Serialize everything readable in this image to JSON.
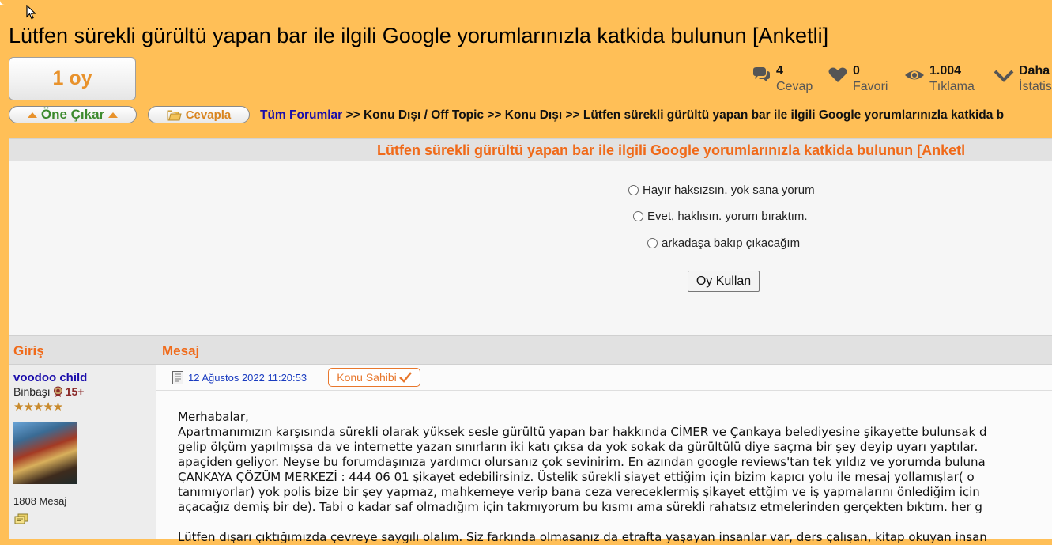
{
  "topic": {
    "title": "Lütfen sürekli gürültü yapan bar ile ilgili Google yorumlarınızla katkida bulunun [Anketli]"
  },
  "vote": {
    "label": "1 oy"
  },
  "actions": {
    "feature_label": "Öne Çıkar",
    "reply_label": "Cevapla"
  },
  "breadcrumb": {
    "items": [
      "Tüm Forumlar",
      "Konu Dışı / Off Topic",
      "Konu Dışı",
      "Lütfen sürekli gürültü yapan bar ile ilgili Google yorumlarınızla katkida b"
    ],
    "separator": ">>"
  },
  "stats": {
    "replies": {
      "value": "4",
      "label": "Cevap",
      "icon": "comments-icon"
    },
    "favorites": {
      "value": "0",
      "label": "Favori",
      "icon": "heart-icon"
    },
    "views": {
      "value": "1.004",
      "label": "Tıklama",
      "icon": "eye-icon"
    },
    "more": {
      "value": "Daha",
      "label": "İstatis",
      "icon": "chevron-down-icon"
    }
  },
  "poll": {
    "header": "Lütfen sürekli gürültü yapan bar ile ilgili Google yorumlarınızla katkida bulunun [Anketl",
    "options": [
      "Hayır haksızsın. yok sana yorum",
      "Evet, haklısın. yorum bıraktım.",
      "arkadaşa bakıp çıkacağım"
    ],
    "submit_label": "Oy Kullan"
  },
  "columns": {
    "left": "Giriş",
    "right": "Mesaj"
  },
  "post": {
    "author": {
      "name": "voodoo child",
      "rank": "Binbaşı",
      "level": "15+",
      "stars": "★★★★★",
      "message_count": "1808 Mesaj"
    },
    "date": "12 Ağustos 2022 11:20:53",
    "owner_badge": "Konu Sahibi",
    "body": {
      "greeting": "Merhabalar,",
      "lines": [
        "Apartmanımızın karşısında sürekli olarak yüksek sesle gürültü yapan bar hakkında CİMER ve Çankaya belediyesine şikayette bulunsak d",
        "gelip ölçüm yapılmışsa da ve internette yazan sınırların iki katı çıksa da yok sokak da gürültülü diye saçma bir şey deyip uyarı yaptılar. ",
        "apaçiden geliyor. Neyse bu forumdaşınıza yardımcı olursanız çok sevinirim. En azından google reviews'tan tek yıldız ve yorumda buluna",
        "ÇANKAYA ÇÖZÜM MERKEZİ : 444 06 01 şikayet edebilirsiniz. Üstelik sürekli şiayet ettiğim için bizim kapıcı yolu ile mesaj yollamışlar( o",
        "tanımıyorlar) yok polis bize bir şey yapmaz, mahkemeye verip bana ceza vereceklermiş şikayet ettğim ve iş yapmalarını önlediğim için",
        "açacağız demiş bir de). Tabi o kadar saf olmadığım için takmıyorum bu kısmı ama sürekli rahatsız etmelerinden gerçekten bıktım. her g"
      ],
      "last_line": "Lütfen dışarı çıktığımızda çevreye saygılı olalım. Siz farkında olmasanız da etrafta yaşayan insanlar var, ders çalışan, kitap okuyan insan"
    }
  },
  "colors": {
    "background": "#ffbf57",
    "accent_orange": "#f06a19",
    "link_blue": "#1a0dab",
    "feature_green": "#3c8a2e"
  }
}
